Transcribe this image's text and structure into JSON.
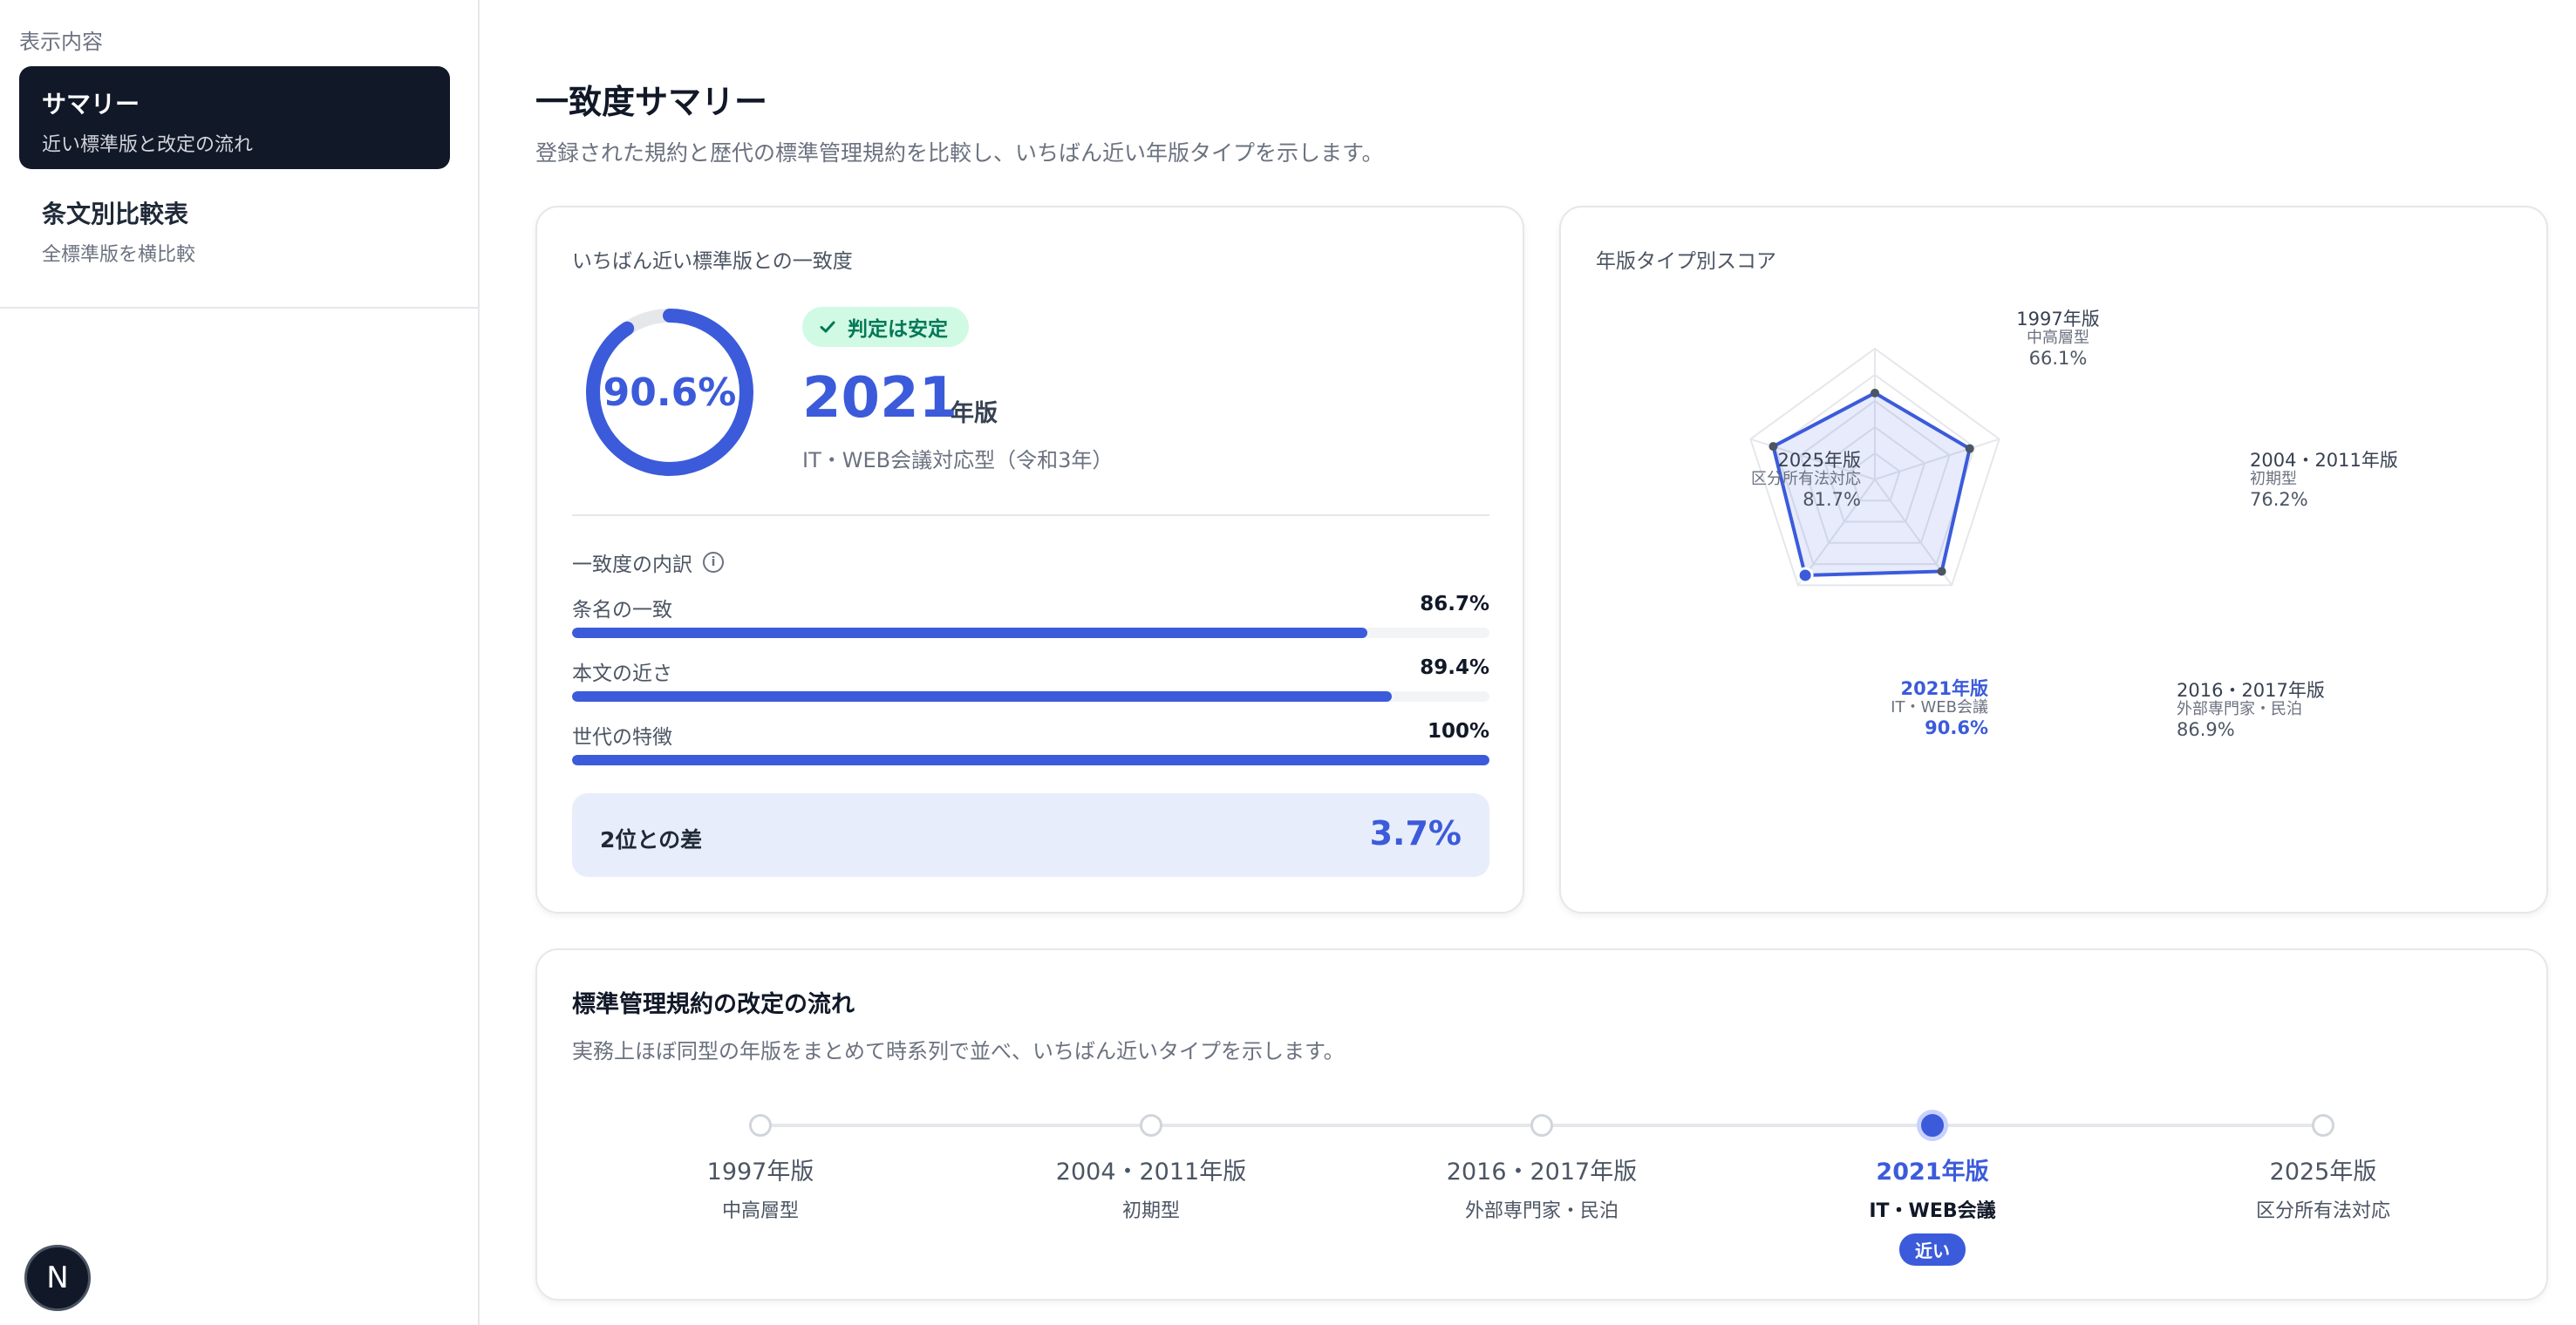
{
  "sidebar": {
    "heading": "表示内容",
    "items": [
      {
        "title": "サマリー",
        "subtitle": "近い標準版と改定の流れ"
      },
      {
        "title": "条文別比較表",
        "subtitle": "全標準版を横比較"
      }
    ],
    "badge": "N"
  },
  "page": {
    "title": "一致度サマリー",
    "subtitle": "登録された規約と歴代の標準管理規約を比較し、いちばん近い年版タイプを示します。"
  },
  "match_card": {
    "label": "いちばん近い標準版との一致度",
    "gauge_value": "90.6%",
    "gauge_fraction": 0.906,
    "status": "判定は安定",
    "year": "2021",
    "year_unit": "年版",
    "type": "IT・WEB会議対応型（令和3年）",
    "breakdown_title": "一致度の内訳",
    "breakdown": [
      {
        "label": "条名の一致",
        "value": "86.7%",
        "fraction": 0.867
      },
      {
        "label": "本文の近さ",
        "value": "89.4%",
        "fraction": 0.894
      },
      {
        "label": "世代の特徴",
        "value": "100%",
        "fraction": 1.0
      }
    ],
    "diff_label": "2位との差",
    "diff_value": "3.7%"
  },
  "radar_card": {
    "label": "年版タイプ別スコア",
    "points": [
      {
        "year": "1997年版",
        "type": "中高層型",
        "score": "66.1%",
        "value": 66.1
      },
      {
        "year": "2004・2011年版",
        "type": "初期型",
        "score": "76.2%",
        "value": 76.2
      },
      {
        "year": "2016・2017年版",
        "type": "外部専門家・民泊",
        "score": "86.9%",
        "value": 86.9
      },
      {
        "year": "2021年版",
        "type": "IT・WEB会議",
        "score": "90.6%",
        "value": 90.6
      },
      {
        "year": "2025年版",
        "type": "区分所有法対応",
        "score": "81.7%",
        "value": 81.7
      }
    ]
  },
  "flow_card": {
    "title": "標準管理規約の改定の流れ",
    "subtitle": "実務上ほぼ同型の年版をまとめて時系列で並べ、いちばん近いタイプを示します。",
    "items": [
      {
        "year": "1997年版",
        "type": "中高層型"
      },
      {
        "year": "2004・2011年版",
        "type": "初期型"
      },
      {
        "year": "2016・2017年版",
        "type": "外部専門家・民泊"
      },
      {
        "year": "2021年版",
        "type": "IT・WEB会議",
        "badge": "近い"
      },
      {
        "year": "2025年版",
        "type": "区分所有法対応"
      }
    ]
  },
  "colors": {
    "accent": "#3b5bdb",
    "success_bg": "#d1fae5",
    "success_text": "#047857"
  }
}
